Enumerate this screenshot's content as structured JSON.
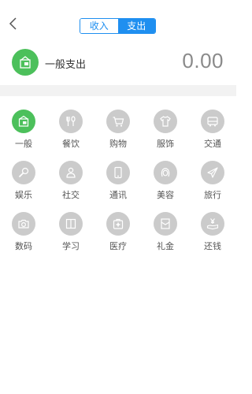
{
  "header": {
    "tabs": [
      {
        "label": "收入",
        "selected": false
      },
      {
        "label": "支出",
        "selected": true
      }
    ],
    "accent_color": "#1f8ff0"
  },
  "summary": {
    "icon": "wallet-icon",
    "category": "一般支出",
    "amount": "0.00"
  },
  "categories": [
    {
      "label": "一般",
      "icon": "wallet-icon",
      "active": true
    },
    {
      "label": "餐饮",
      "icon": "fork-spoon-icon"
    },
    {
      "label": "购物",
      "icon": "cart-icon"
    },
    {
      "label": "服饰",
      "icon": "shirt-icon"
    },
    {
      "label": "交通",
      "icon": "bus-icon"
    },
    {
      "label": "娱乐",
      "icon": "microphone-icon"
    },
    {
      "label": "社交",
      "icon": "people-icon"
    },
    {
      "label": "通讯",
      "icon": "phone-icon"
    },
    {
      "label": "美容",
      "icon": "face-icon"
    },
    {
      "label": "旅行",
      "icon": "airplane-icon"
    },
    {
      "label": "数码",
      "icon": "camera-icon"
    },
    {
      "label": "学习",
      "icon": "book-icon"
    },
    {
      "label": "医疗",
      "icon": "medical-kit-icon"
    },
    {
      "label": "礼金",
      "icon": "envelope-icon"
    },
    {
      "label": "还钱",
      "icon": "yen-hand-icon"
    }
  ],
  "colors": {
    "active": "#4cc05b",
    "inactive": "#cbcbcb"
  }
}
